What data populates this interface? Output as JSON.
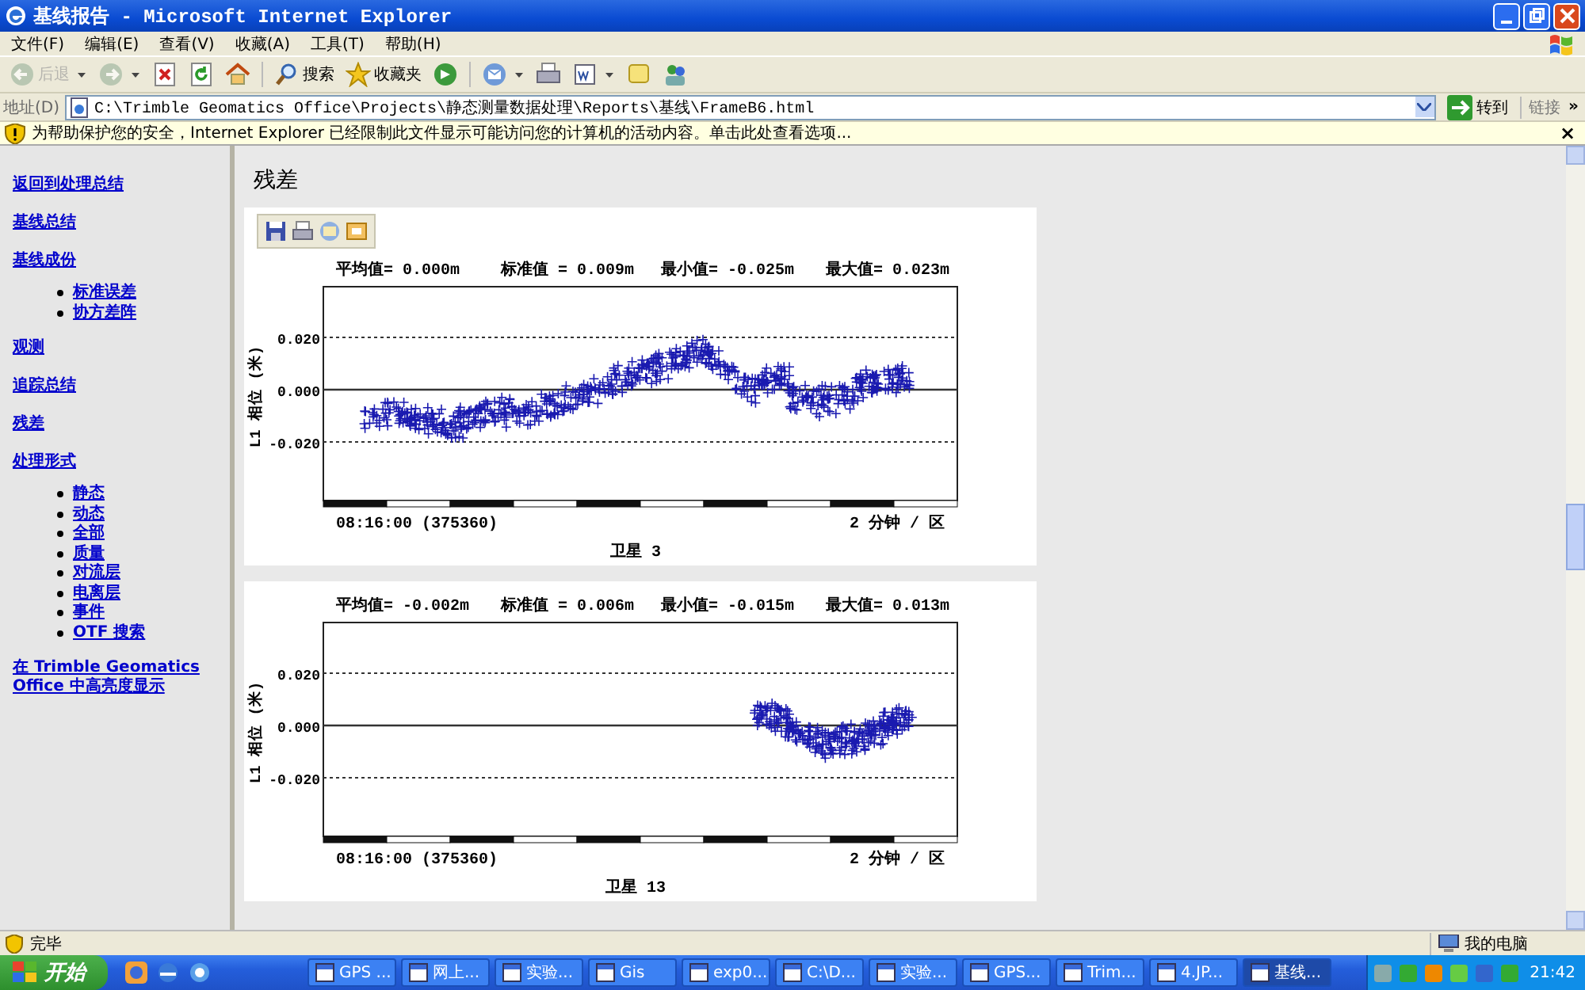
{
  "window": {
    "title": "基线报告 - Microsoft Internet Explorer"
  },
  "menu": [
    {
      "label": "文件(F)"
    },
    {
      "label": "编辑(E)"
    },
    {
      "label": "查看(V)"
    },
    {
      "label": "收藏(A)"
    },
    {
      "label": "工具(T)"
    },
    {
      "label": "帮助(H)"
    }
  ],
  "toolbar": [
    {
      "kind": "back",
      "label": "后退",
      "disabled": true,
      "dropdown": true
    },
    {
      "kind": "forward",
      "disabled": true,
      "dropdown": true
    },
    {
      "kind": "stop",
      "disabled": false,
      "dropdown": false
    },
    {
      "kind": "refresh",
      "disabled": false,
      "dropdown": false
    },
    {
      "kind": "home",
      "disabled": false,
      "dropdown": false
    },
    {
      "kind": "search",
      "label": "搜索",
      "disabled": false,
      "dropdown": false
    },
    {
      "kind": "favorites",
      "label": "收藏夹",
      "disabled": false,
      "dropdown": false
    },
    {
      "kind": "media",
      "disabled": false,
      "dropdown": false
    },
    {
      "kind": "mail",
      "disabled": false,
      "dropdown": true
    },
    {
      "kind": "print",
      "disabled": false,
      "dropdown": false
    },
    {
      "kind": "edit",
      "disabled": false,
      "dropdown": true
    },
    {
      "kind": "discuss",
      "disabled": false,
      "dropdown": false
    },
    {
      "kind": "messenger",
      "disabled": false,
      "dropdown": false
    }
  ],
  "address_bar": {
    "label": "地址(D)",
    "value": "C:\\Trimble Geomatics Office\\Projects\\静态测量数据处理\\Reports\\基线\\FrameB6.html",
    "go_label": "转到",
    "links_label": "链接",
    "more": "»"
  },
  "info_bar": {
    "text": "为帮助保护您的安全，Internet Explorer 已经限制此文件显示可能访问您的计算机的活动内容。单击此处查看选项...",
    "close": "×"
  },
  "sidebar": {
    "items": [
      {
        "label": "返回到处理总结"
      },
      {
        "label": "基线总结"
      },
      {
        "label": "基线成份",
        "children": [
          {
            "label": "标准误差"
          },
          {
            "label": "协方差阵"
          }
        ]
      },
      {
        "label": "观测"
      },
      {
        "label": "追踪总结"
      },
      {
        "label": "残差"
      },
      {
        "label": "处理形式",
        "children": [
          {
            "label": "静态"
          },
          {
            "label": "动态"
          },
          {
            "label": "全部"
          },
          {
            "label": "质量"
          },
          {
            "label": "对流层"
          },
          {
            "label": "电离层"
          },
          {
            "label": "事件"
          },
          {
            "label": "OTF 搜索"
          }
        ]
      },
      {
        "label": "在 Trimble Geomatics Office 中高亮度显示"
      }
    ]
  },
  "main": {
    "heading": "残差",
    "charts": [
      {
        "toolbar": true,
        "stats": [
          "平均值= 0.000m",
          "标准值 = 0.009m",
          "最小值= -0.025m",
          "最大值= 0.023m"
        ],
        "y_label": "L1 相位 (米)",
        "y_ticks": [
          "0.020",
          "0.000",
          "-0.020"
        ],
        "x_start": "08:16:00 (375360)",
        "x_scale": "2 分钟 / 区",
        "title": "卫星 3"
      },
      {
        "toolbar": false,
        "stats": [
          "平均值= -0.002m",
          "标准值 = 0.006m",
          "最小值= -0.015m",
          "最大值= 0.013m"
        ],
        "y_label": "L1 相位 (米)",
        "y_ticks": [
          "0.020",
          "0.000",
          "-0.020"
        ],
        "x_start": "08:16:00 (375360)",
        "x_scale": "2 分钟 / 区",
        "title": "卫星 13"
      }
    ]
  },
  "status_bar": {
    "text": "完毕",
    "zone": "我的电脑"
  },
  "taskbar": {
    "start": "开始",
    "tasks": [
      {
        "label": "GPS ...",
        "selected": false
      },
      {
        "label": "网上...",
        "selected": false
      },
      {
        "label": "实验...",
        "selected": false
      },
      {
        "label": "Gis",
        "selected": false
      },
      {
        "label": "exp0...",
        "selected": false
      },
      {
        "label": "C:\\D...",
        "selected": false
      },
      {
        "label": "实验...",
        "selected": false
      },
      {
        "label": "GPS...",
        "selected": false
      },
      {
        "label": "Trim...",
        "selected": false
      },
      {
        "label": "4.JP...",
        "selected": false
      },
      {
        "label": "基线...",
        "selected": true
      }
    ],
    "clock": "21:42"
  }
}
